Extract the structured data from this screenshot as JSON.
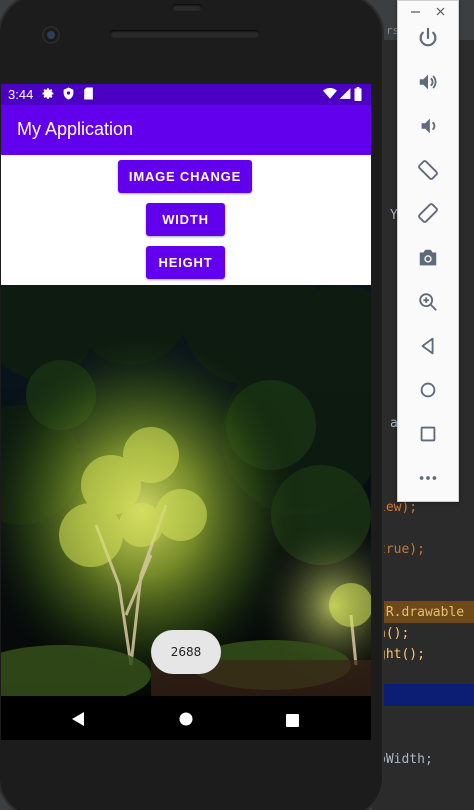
{
  "status_bar": {
    "time": "3:44",
    "icons": [
      "gear-icon",
      "shield-icon",
      "sdcard-icon",
      "wifi-icon",
      "signal-icon",
      "battery-icon"
    ]
  },
  "app_bar": {
    "title": "My Application"
  },
  "buttons": {
    "image_change": "IMAGE CHANGE",
    "width": "WIDTH",
    "height": "HEIGHT"
  },
  "toast": {
    "text": "2688"
  },
  "nav_bar": {
    "icons": [
      "back-icon",
      "home-icon",
      "recents-icon"
    ]
  },
  "emulator_toolbar": {
    "window_controls": [
      "minimize-icon",
      "close-icon"
    ],
    "items": [
      "power-icon",
      "volume-up-icon",
      "volume-down-icon",
      "rotate-left-icon",
      "rotate-right-icon",
      "camera-icon",
      "zoom-icon",
      "back-icon",
      "home-icon",
      "overview-icon",
      "more-icon"
    ]
  },
  "ide_code": {
    "tab_text": "rs  llro",
    "lines": [
      "Y",
      "a",
      "iew);",
      "true);",
      "(R.drawable",
      "h();",
      "ght();",
      "pWidth;"
    ]
  },
  "colors": {
    "primary": "#6200ee",
    "primary_dark": "#4c00c4",
    "ide_background": "#2b2b2b",
    "ide_highlight_orange": "#6e4a1a",
    "ide_highlight_blue": "#0b1e73"
  }
}
